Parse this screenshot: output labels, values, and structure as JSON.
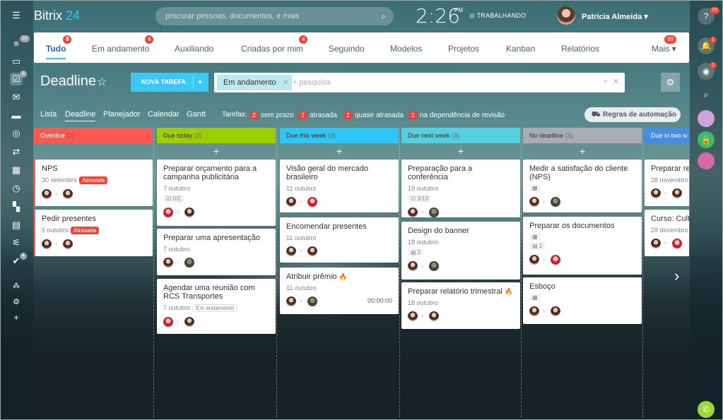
{
  "app": {
    "logo_main": "Bitrix",
    "logo_accent": "24"
  },
  "header": {
    "search_placeholder": "procurar pessoas, documentos, e mais",
    "time": "2:26",
    "ampm": "PM",
    "work_status": "TRABALHANDO",
    "user_name": "Patricia Almeida"
  },
  "leftbar": {
    "counters": {
      "filter": "10",
      "tasks": "8",
      "check": "4"
    }
  },
  "rightbar": {
    "help_count": "15",
    "notif_count": "1",
    "chat_count": "1"
  },
  "tabs": [
    {
      "label": "Tudo",
      "badge": "8"
    },
    {
      "label": "Em andamento",
      "badge": "4"
    },
    {
      "label": "Auxiliando",
      "badge": ""
    },
    {
      "label": "Criadas por mim",
      "badge": "4"
    },
    {
      "label": "Seguindo",
      "badge": ""
    },
    {
      "label": "Modelos",
      "badge": ""
    },
    {
      "label": "Projetos",
      "badge": ""
    },
    {
      "label": "Kanban",
      "badge": ""
    },
    {
      "label": "Relatórios",
      "badge": ""
    },
    {
      "label": "Mais",
      "badge": "99"
    }
  ],
  "toolbar": {
    "title": "Deadline",
    "new_task": "NOVA TAREFA",
    "filter_chip": "Em andamento",
    "filter_placeholder": "+ pesquisa"
  },
  "views": {
    "list": "Lista",
    "deadline": "Deadline",
    "planner": "Planejador",
    "calendar": "Calendar",
    "gantt": "Gantt",
    "tasks_label": "Tarefas:",
    "c1": "2",
    "l1": "sem prazo",
    "c2": "2",
    "l2": "atrasada",
    "c3": "2",
    "l3": "quase atrasada",
    "c4": "2",
    "l4": "na dependência de revisão",
    "automation": "Regras de automação"
  },
  "colors": {
    "overdue": "#ff5752",
    "today": "#9dcf00",
    "week": "#2fc6f6",
    "nextweek": "#55d0e0",
    "nodeadline": "#a8adb4",
    "twoweeks": "#468ee5"
  },
  "columns": [
    {
      "title": "Overdue",
      "count": "(2)"
    },
    {
      "title": "Due today",
      "count": "(3)"
    },
    {
      "title": "Due this week",
      "count": "(3)"
    },
    {
      "title": "Due next week",
      "count": "(3)"
    },
    {
      "title": "No deadline",
      "count": "(3)"
    },
    {
      "title": "Due in two w",
      "count": ""
    }
  ],
  "cards": {
    "c0a": {
      "title": "NPS",
      "date": "30 setembro",
      "tag": "Atrasada"
    },
    "c0b": {
      "title": "Pedir presentes",
      "date": "5 outubro",
      "tag": "Atrasada"
    },
    "c1a": {
      "title": "Preparar orçamento para a campanha publicitária",
      "date": "7 outubro",
      "check": "0/2"
    },
    "c1b": {
      "title": "Preparar uma apresentação",
      "date": "7 outubro"
    },
    "c1c": {
      "title": "Agendar uma reunião com RCS Transportes",
      "date": "7 outubro",
      "tag": "Em andamento"
    },
    "c2a": {
      "title": "Visão geral do mercado brasileiro",
      "date": "11 outubro"
    },
    "c2b": {
      "title": "Encomendar presentes",
      "date": "11 outubro"
    },
    "c2c": {
      "title": "Atribuir prêmio",
      "date": "11 outubro",
      "timer": "00:00:00"
    },
    "c3a": {
      "title": "Preparação para a conferência",
      "date": "18 outubro",
      "check": "3/13"
    },
    "c3b": {
      "title": "Design do banner",
      "date": "18 outubro",
      "comments": "2"
    },
    "c3c": {
      "title": "Preparar relatório trimestral",
      "date": "18 outubro"
    },
    "c4a": {
      "title": "Medir a satisfação do cliente (NPS)"
    },
    "c4b": {
      "title": "Preparar os documentos",
      "comments": "2"
    },
    "c4c": {
      "title": "Esboço"
    },
    "c5a": {
      "title": "Preparar rela",
      "date": "28 novembro"
    },
    "c5b": {
      "title": "Curso: Cultu",
      "date": "28 dezembro"
    }
  }
}
